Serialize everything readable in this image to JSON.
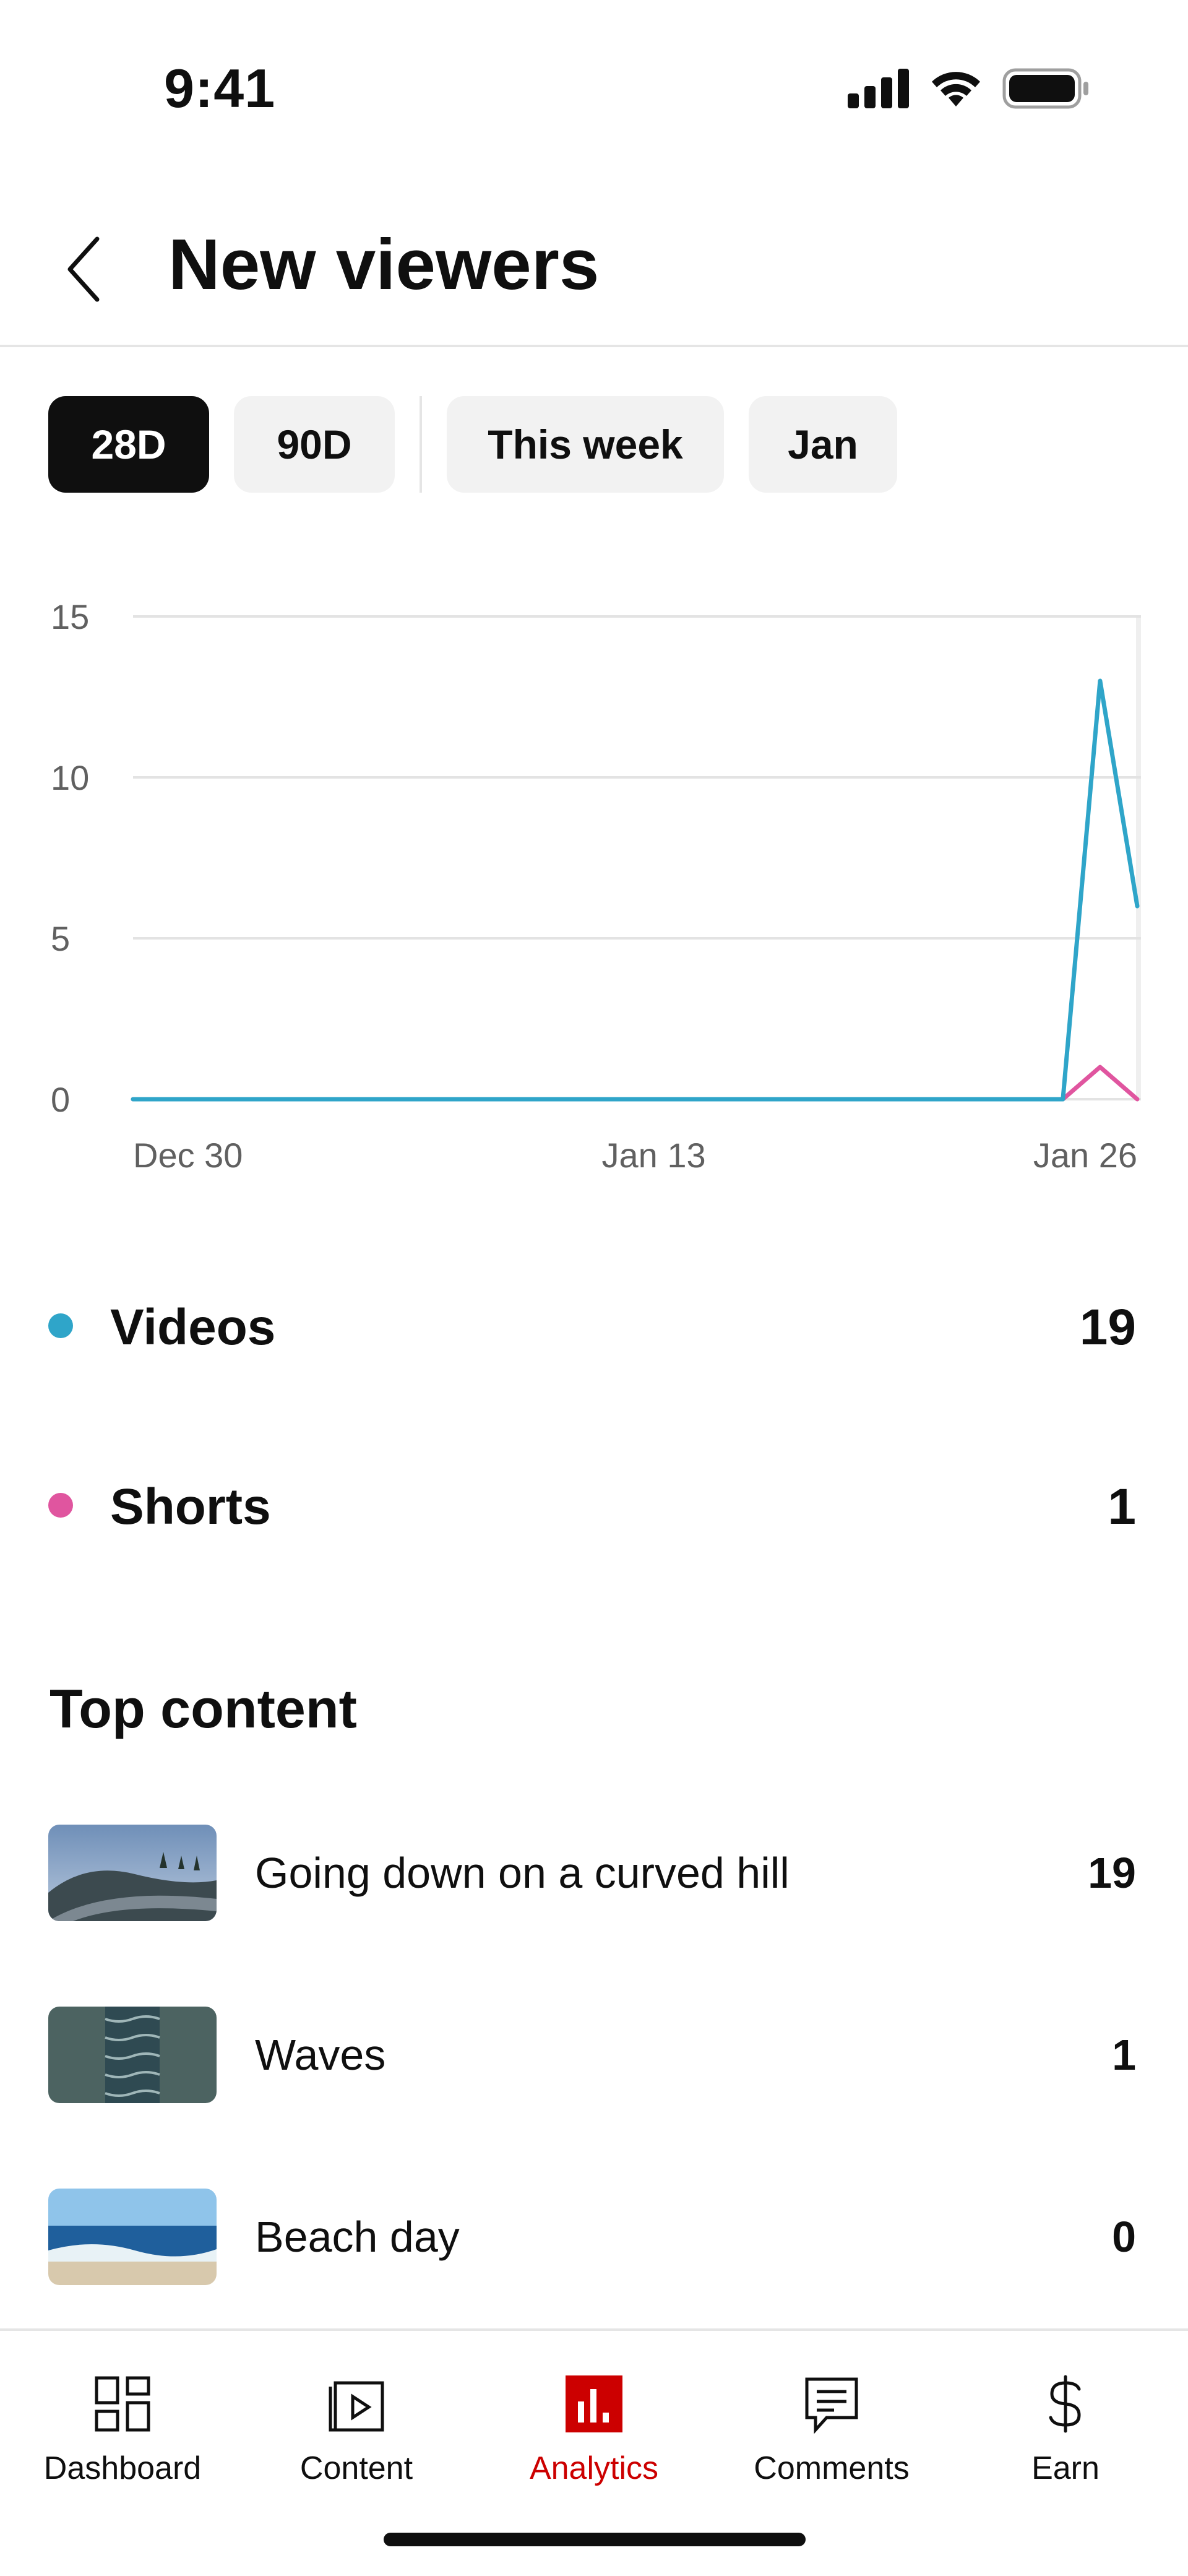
{
  "status_bar": {
    "time": "9:41"
  },
  "header": {
    "title": "New viewers"
  },
  "filters": {
    "chips": [
      {
        "label": "28D",
        "active": true
      },
      {
        "label": "90D",
        "active": false
      },
      {
        "label": "This week",
        "active": false
      },
      {
        "label": "Jan",
        "active": false
      }
    ]
  },
  "chart_data": {
    "type": "line",
    "x": [
      "Dec 30",
      "Dec 31",
      "Jan 1",
      "Jan 2",
      "Jan 3",
      "Jan 4",
      "Jan 5",
      "Jan 6",
      "Jan 7",
      "Jan 8",
      "Jan 9",
      "Jan 10",
      "Jan 11",
      "Jan 12",
      "Jan 13",
      "Jan 14",
      "Jan 15",
      "Jan 16",
      "Jan 17",
      "Jan 18",
      "Jan 19",
      "Jan 20",
      "Jan 21",
      "Jan 22",
      "Jan 23",
      "Jan 24",
      "Jan 25",
      "Jan 26"
    ],
    "x_tick_labels": [
      "Dec 30",
      "Jan 13",
      "Jan 26"
    ],
    "y_tick_labels": [
      "0",
      "5",
      "10",
      "15"
    ],
    "ylim": [
      0,
      15
    ],
    "grid": true,
    "highlight_last_day": true,
    "series": [
      {
        "name": "Videos",
        "color": "#2fa5c9",
        "values": [
          0,
          0,
          0,
          0,
          0,
          0,
          0,
          0,
          0,
          0,
          0,
          0,
          0,
          0,
          0,
          0,
          0,
          0,
          0,
          0,
          0,
          0,
          0,
          0,
          0,
          0,
          13,
          6
        ]
      },
      {
        "name": "Shorts",
        "color": "#e0559f",
        "values": [
          0,
          0,
          0,
          0,
          0,
          0,
          0,
          0,
          0,
          0,
          0,
          0,
          0,
          0,
          0,
          0,
          0,
          0,
          0,
          0,
          0,
          0,
          0,
          0,
          0,
          0,
          1,
          0
        ]
      }
    ]
  },
  "legend": [
    {
      "label": "Videos",
      "value": "19",
      "color": "#2fa5c9"
    },
    {
      "label": "Shorts",
      "value": "1",
      "color": "#e0559f"
    }
  ],
  "top_content": {
    "title": "Top content",
    "items": [
      {
        "title": "Going down on a curved hill",
        "value": "19"
      },
      {
        "title": "Waves",
        "value": "1"
      },
      {
        "title": "Beach day",
        "value": "0"
      }
    ]
  },
  "nav": {
    "items": [
      {
        "label": "Dashboard",
        "icon": "dashboard-icon",
        "active": false
      },
      {
        "label": "Content",
        "icon": "content-icon",
        "active": false
      },
      {
        "label": "Analytics",
        "icon": "analytics-icon",
        "active": true
      },
      {
        "label": "Comments",
        "icon": "comments-icon",
        "active": false
      },
      {
        "label": "Earn",
        "icon": "earn-icon",
        "active": false
      }
    ],
    "active_color": "#cc0000"
  }
}
